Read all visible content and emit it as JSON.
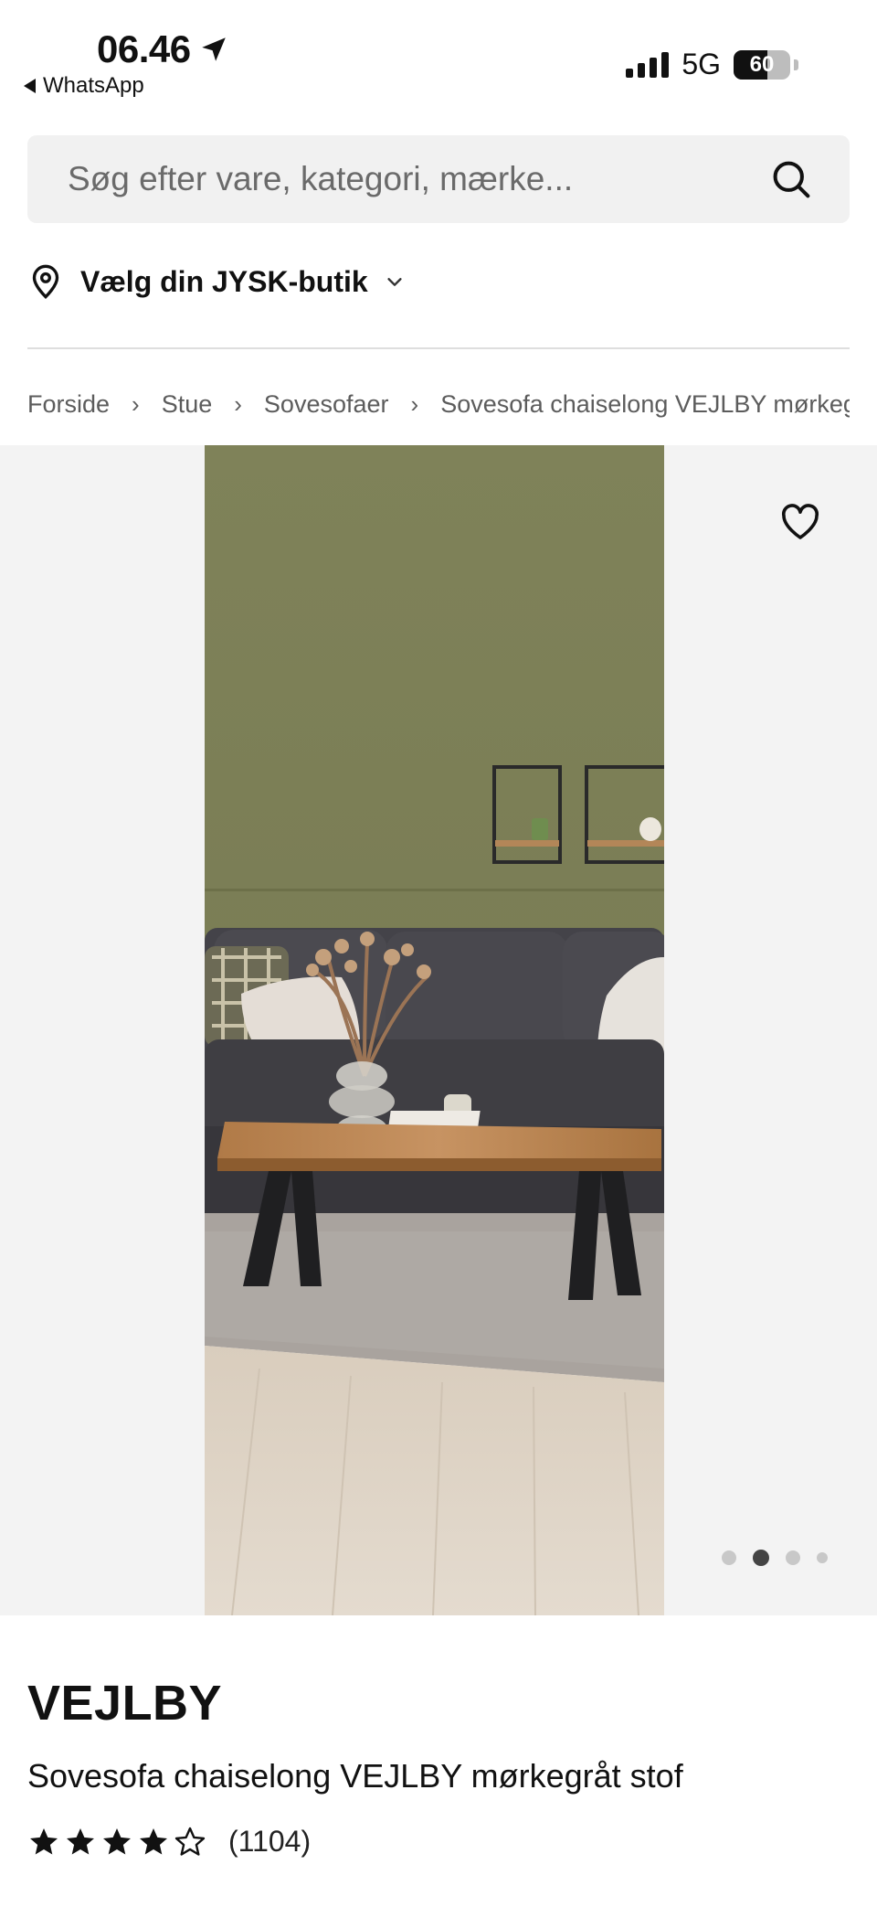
{
  "status_bar": {
    "time": "06.46",
    "back_app": "WhatsApp",
    "network": "5G",
    "battery": "60",
    "battery_level": 0.6
  },
  "search": {
    "placeholder": "Søg efter vare, kategori, mærke..."
  },
  "store_selector": {
    "label": "Vælg din JYSK-butik"
  },
  "breadcrumb": [
    "Forside",
    "Stue",
    "Sovesofaer",
    "Sovesofa chaiselong VEJLBY mørkegråt stof"
  ],
  "gallery": {
    "image_count": 4,
    "active_index": 1
  },
  "product": {
    "brand": "VEJLBY",
    "name": "Sovesofa chaiselong VEJLBY mørkegråt stof",
    "rating": 4,
    "rating_max": 5,
    "review_count": "(1104)"
  },
  "colors": {
    "wall": "#7d8058",
    "floor": "#ddd2c4",
    "sofa": "#3f3e43",
    "page_bg": "#f3f3f3"
  }
}
